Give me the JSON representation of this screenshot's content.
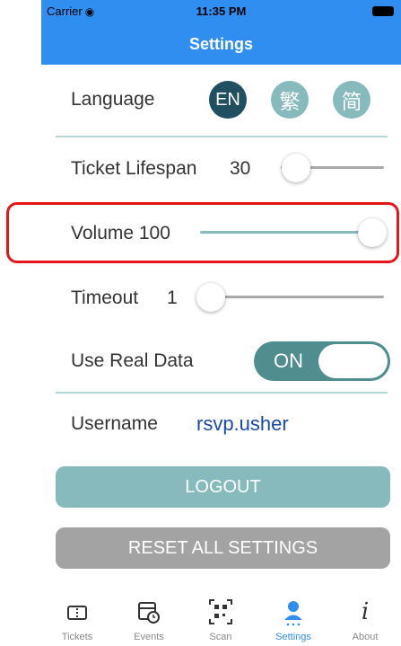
{
  "status_bar": {
    "carrier": "Carrier",
    "time": "11:35 PM"
  },
  "nav": {
    "title": "Settings"
  },
  "language": {
    "label": "Language",
    "options": [
      "EN",
      "繁",
      "简"
    ],
    "selected": "EN"
  },
  "ticket_lifespan": {
    "label": "Ticket Lifespan",
    "value": "30",
    "level": 0.05
  },
  "volume": {
    "label": "Volume 100",
    "level": 1.0
  },
  "timeout": {
    "label": "Timeout",
    "value": "1",
    "level": 0.0
  },
  "use_real_data": {
    "label": "Use Real Data",
    "state": "ON"
  },
  "username": {
    "label": "Username",
    "value": "rsvp.usher"
  },
  "buttons": {
    "logout": "LOGOUT",
    "reset": "RESET ALL SETTINGS"
  },
  "tabs": [
    {
      "label": "Tickets",
      "icon": "ticket-icon"
    },
    {
      "label": "Events",
      "icon": "calendar-clock-icon"
    },
    {
      "label": "Scan",
      "icon": "qr-scan-icon"
    },
    {
      "label": "Settings",
      "icon": "user-settings-icon",
      "active": true
    },
    {
      "label": "About",
      "icon": "info-icon"
    }
  ],
  "colors": {
    "accent": "#2f8ef0",
    "teal": "#87babd",
    "dark_teal": "#1f4f61",
    "highlight": "#e8141c"
  }
}
